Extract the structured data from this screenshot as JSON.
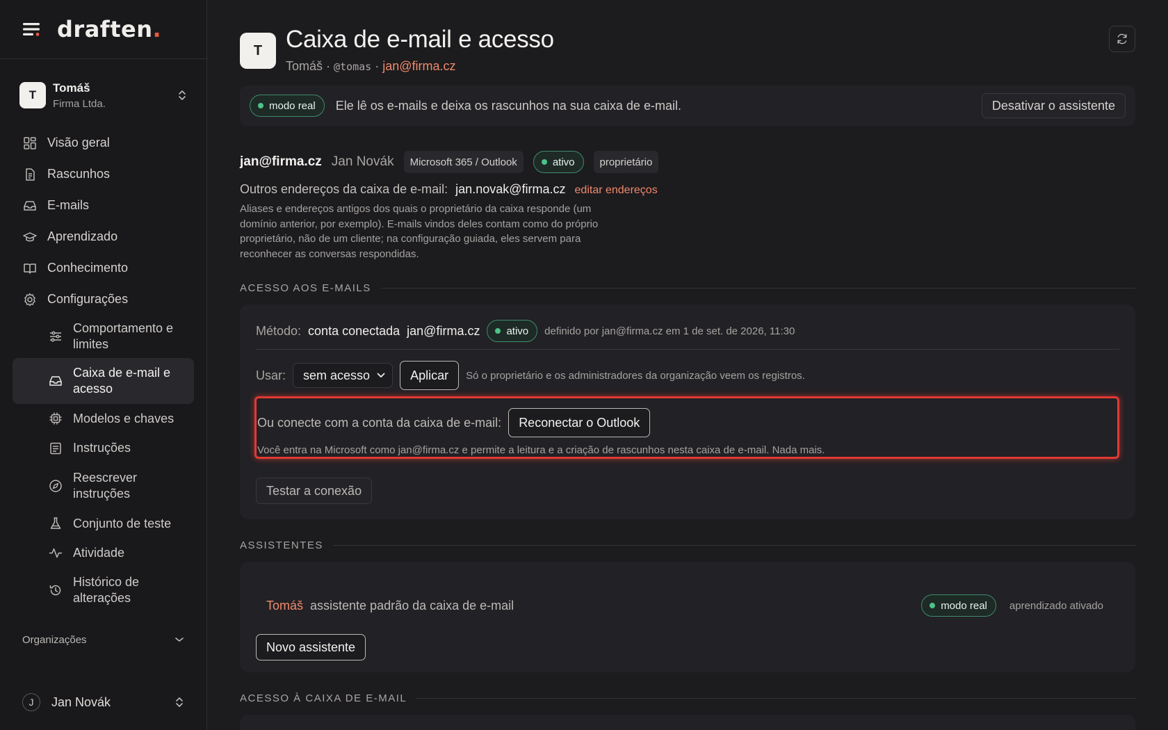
{
  "brand": {
    "name": "draften",
    "dot": "."
  },
  "workspace": {
    "avatar": "T",
    "name": "Tomáš",
    "org": "Firma Ltda."
  },
  "nav": {
    "items": [
      {
        "label": "Visão geral",
        "icon": "grid-icon"
      },
      {
        "label": "Rascunhos",
        "icon": "document-icon"
      },
      {
        "label": "E-mails",
        "icon": "inbox-icon"
      },
      {
        "label": "Aprendizado",
        "icon": "graduation-cap-icon"
      },
      {
        "label": "Conhecimento",
        "icon": "book-icon"
      },
      {
        "label": "Configurações",
        "icon": "gear-icon"
      }
    ],
    "sub_items": [
      {
        "label": "Comportamento e limites",
        "icon": "sliders-icon"
      },
      {
        "label": "Caixa de e-mail e acesso",
        "icon": "inbox-icon",
        "active": true
      },
      {
        "label": "Modelos e chaves",
        "icon": "chip-icon"
      },
      {
        "label": "Instruções",
        "icon": "list-icon"
      },
      {
        "label": "Reescrever instruções",
        "icon": "compass-icon"
      },
      {
        "label": "Conjunto de teste",
        "icon": "flask-icon"
      },
      {
        "label": "Atividade",
        "icon": "activity-icon"
      },
      {
        "label": "Histórico de alterações",
        "icon": "history-icon"
      }
    ],
    "orgs_label": "Organizações"
  },
  "user": {
    "avatar": "J",
    "name": "Jan Novák"
  },
  "header": {
    "avatar": "T",
    "title": "Caixa de e-mail e acesso",
    "meta_name": "Tomáš",
    "meta_sep": " · ",
    "meta_handle": "@tomas",
    "meta_email": "jan@firma.cz"
  },
  "banner": {
    "pill": "modo real",
    "text": "Ele lê os e-mails e deixa os rascunhos na sua caixa de e-mail.",
    "button": "Desativar o assistente"
  },
  "account": {
    "email": "jan@firma.cz",
    "name": "Jan Novák",
    "provider": "Microsoft 365 / Outlook",
    "status": "ativo",
    "role": "proprietário"
  },
  "other_addresses": {
    "label": "Outros endereços da caixa de e-mail:",
    "value": "jan.novak@firma.cz",
    "edit_link": "editar endereços",
    "help": "Aliases e endereços antigos dos quais o proprietário da caixa responde (um domínio anterior, por exemplo). E-mails vindos deles contam como do próprio proprietário, não de um cliente; na configuração guiada, eles servem para reconhecer as conversas respondidas."
  },
  "access": {
    "section_title": "ACESSO AOS E-MAILS",
    "method_label": "Método:",
    "method_value": "conta conectada",
    "method_email": "jan@firma.cz",
    "status": "ativo",
    "defined_by": "definido por jan@firma.cz em 1 de set. de 2026, 11:30",
    "use_label": "Usar:",
    "select_value": "sem acesso",
    "apply_button": "Aplicar",
    "note": "Só o proprietário e os administradores da organização veem os registros.",
    "connect_label": "Ou conecte com a conta da caixa de e-mail:",
    "reconnect_button": "Reconectar o Outlook",
    "connect_help": "Você entra na Microsoft como jan@firma.cz e permite a leitura e a criação de rascunhos nesta caixa de e-mail. Nada mais.",
    "test_button": "Testar a conexão"
  },
  "assistants": {
    "section_title": "ASSISTENTES",
    "name": "Tomáš",
    "description": "assistente padrão da caixa de e-mail",
    "pill": "modo real",
    "learning": "aprendizado ativado",
    "new_button": "Novo assistente"
  },
  "mailbox_access": {
    "section_title": "ACESSO À CAIXA DE E-MAIL"
  },
  "colors": {
    "accent": "#ef8a6c",
    "green": "#4cc38a",
    "highlight": "#e03a33",
    "background": "#1c1b1e"
  }
}
